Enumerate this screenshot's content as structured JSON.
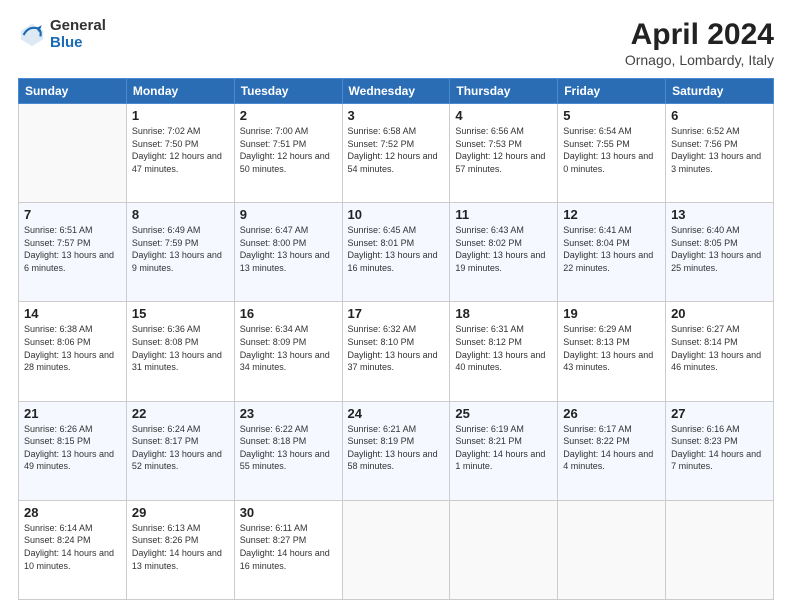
{
  "logo": {
    "general": "General",
    "blue": "Blue"
  },
  "title": "April 2024",
  "subtitle": "Ornago, Lombardy, Italy",
  "weekdays": [
    "Sunday",
    "Monday",
    "Tuesday",
    "Wednesday",
    "Thursday",
    "Friday",
    "Saturday"
  ],
  "weeks": [
    [
      {
        "day": "",
        "info": ""
      },
      {
        "day": "1",
        "info": "Sunrise: 7:02 AM\nSunset: 7:50 PM\nDaylight: 12 hours\nand 47 minutes."
      },
      {
        "day": "2",
        "info": "Sunrise: 7:00 AM\nSunset: 7:51 PM\nDaylight: 12 hours\nand 50 minutes."
      },
      {
        "day": "3",
        "info": "Sunrise: 6:58 AM\nSunset: 7:52 PM\nDaylight: 12 hours\nand 54 minutes."
      },
      {
        "day": "4",
        "info": "Sunrise: 6:56 AM\nSunset: 7:53 PM\nDaylight: 12 hours\nand 57 minutes."
      },
      {
        "day": "5",
        "info": "Sunrise: 6:54 AM\nSunset: 7:55 PM\nDaylight: 13 hours\nand 0 minutes."
      },
      {
        "day": "6",
        "info": "Sunrise: 6:52 AM\nSunset: 7:56 PM\nDaylight: 13 hours\nand 3 minutes."
      }
    ],
    [
      {
        "day": "7",
        "info": "Sunrise: 6:51 AM\nSunset: 7:57 PM\nDaylight: 13 hours\nand 6 minutes."
      },
      {
        "day": "8",
        "info": "Sunrise: 6:49 AM\nSunset: 7:59 PM\nDaylight: 13 hours\nand 9 minutes."
      },
      {
        "day": "9",
        "info": "Sunrise: 6:47 AM\nSunset: 8:00 PM\nDaylight: 13 hours\nand 13 minutes."
      },
      {
        "day": "10",
        "info": "Sunrise: 6:45 AM\nSunset: 8:01 PM\nDaylight: 13 hours\nand 16 minutes."
      },
      {
        "day": "11",
        "info": "Sunrise: 6:43 AM\nSunset: 8:02 PM\nDaylight: 13 hours\nand 19 minutes."
      },
      {
        "day": "12",
        "info": "Sunrise: 6:41 AM\nSunset: 8:04 PM\nDaylight: 13 hours\nand 22 minutes."
      },
      {
        "day": "13",
        "info": "Sunrise: 6:40 AM\nSunset: 8:05 PM\nDaylight: 13 hours\nand 25 minutes."
      }
    ],
    [
      {
        "day": "14",
        "info": "Sunrise: 6:38 AM\nSunset: 8:06 PM\nDaylight: 13 hours\nand 28 minutes."
      },
      {
        "day": "15",
        "info": "Sunrise: 6:36 AM\nSunset: 8:08 PM\nDaylight: 13 hours\nand 31 minutes."
      },
      {
        "day": "16",
        "info": "Sunrise: 6:34 AM\nSunset: 8:09 PM\nDaylight: 13 hours\nand 34 minutes."
      },
      {
        "day": "17",
        "info": "Sunrise: 6:32 AM\nSunset: 8:10 PM\nDaylight: 13 hours\nand 37 minutes."
      },
      {
        "day": "18",
        "info": "Sunrise: 6:31 AM\nSunset: 8:12 PM\nDaylight: 13 hours\nand 40 minutes."
      },
      {
        "day": "19",
        "info": "Sunrise: 6:29 AM\nSunset: 8:13 PM\nDaylight: 13 hours\nand 43 minutes."
      },
      {
        "day": "20",
        "info": "Sunrise: 6:27 AM\nSunset: 8:14 PM\nDaylight: 13 hours\nand 46 minutes."
      }
    ],
    [
      {
        "day": "21",
        "info": "Sunrise: 6:26 AM\nSunset: 8:15 PM\nDaylight: 13 hours\nand 49 minutes."
      },
      {
        "day": "22",
        "info": "Sunrise: 6:24 AM\nSunset: 8:17 PM\nDaylight: 13 hours\nand 52 minutes."
      },
      {
        "day": "23",
        "info": "Sunrise: 6:22 AM\nSunset: 8:18 PM\nDaylight: 13 hours\nand 55 minutes."
      },
      {
        "day": "24",
        "info": "Sunrise: 6:21 AM\nSunset: 8:19 PM\nDaylight: 13 hours\nand 58 minutes."
      },
      {
        "day": "25",
        "info": "Sunrise: 6:19 AM\nSunset: 8:21 PM\nDaylight: 14 hours\nand 1 minute."
      },
      {
        "day": "26",
        "info": "Sunrise: 6:17 AM\nSunset: 8:22 PM\nDaylight: 14 hours\nand 4 minutes."
      },
      {
        "day": "27",
        "info": "Sunrise: 6:16 AM\nSunset: 8:23 PM\nDaylight: 14 hours\nand 7 minutes."
      }
    ],
    [
      {
        "day": "28",
        "info": "Sunrise: 6:14 AM\nSunset: 8:24 PM\nDaylight: 14 hours\nand 10 minutes."
      },
      {
        "day": "29",
        "info": "Sunrise: 6:13 AM\nSunset: 8:26 PM\nDaylight: 14 hours\nand 13 minutes."
      },
      {
        "day": "30",
        "info": "Sunrise: 6:11 AM\nSunset: 8:27 PM\nDaylight: 14 hours\nand 16 minutes."
      },
      {
        "day": "",
        "info": ""
      },
      {
        "day": "",
        "info": ""
      },
      {
        "day": "",
        "info": ""
      },
      {
        "day": "",
        "info": ""
      }
    ]
  ]
}
